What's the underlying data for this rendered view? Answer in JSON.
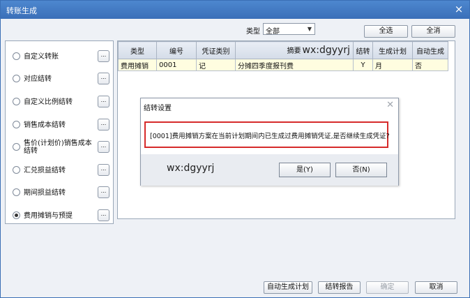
{
  "window": {
    "title": "转账生成",
    "close_glyph": "×"
  },
  "type_filter": {
    "label": "类型",
    "value": "全部"
  },
  "top_buttons": {
    "select_all": "全选",
    "clear_all": "全消"
  },
  "transfer_types": [
    {
      "label": "自定义转账",
      "selected": false
    },
    {
      "label": "对应结转",
      "selected": false
    },
    {
      "label": "自定义比例结转",
      "selected": false
    },
    {
      "label": "销售成本结转",
      "selected": false
    },
    {
      "label": "售价(计划价)销售成本结转",
      "selected": false
    },
    {
      "label": "汇兑损益结转",
      "selected": false
    },
    {
      "label": "期间损益结转",
      "selected": false
    },
    {
      "label": "费用摊销与预提",
      "selected": true
    }
  ],
  "more_button_label": "...",
  "table": {
    "headers": [
      "类型",
      "编号",
      "凭证类别",
      "摘要",
      "结转",
      "生成计划",
      "自动生成"
    ],
    "watermark": "wx:dgyyrj",
    "rows": [
      [
        "费用摊销",
        "0001",
        "记",
        "分摊四季度报刊费",
        "Y",
        "月",
        "否"
      ]
    ]
  },
  "dialog": {
    "title": "结转设置",
    "message": "[0001]费用摊销方案在当前计划期间内已生成过费用摊销凭证,是否继续生成凭证?",
    "watermark": "wx:dgyyrj",
    "yes_label": "是(Y)",
    "no_label": "否(N)"
  },
  "bottom_buttons": {
    "auto_plan": "自动生成计划",
    "report": "结转报告",
    "ok": "确定",
    "cancel": "取消"
  }
}
